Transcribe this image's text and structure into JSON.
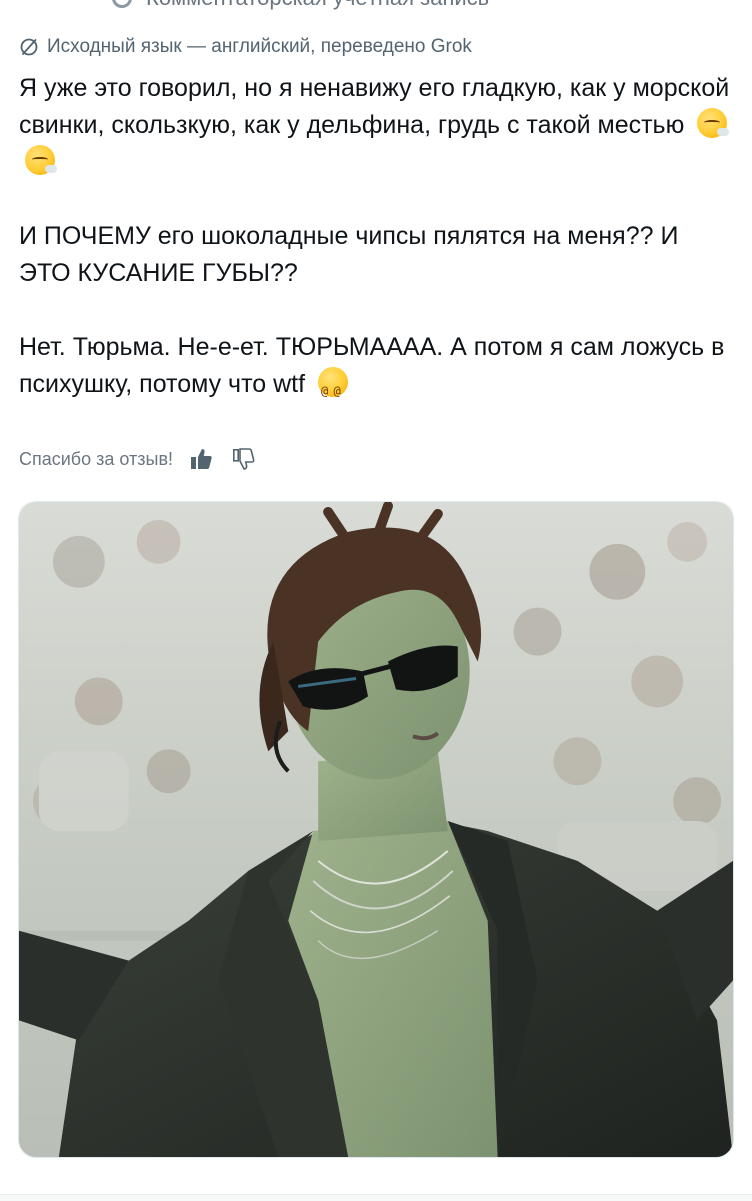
{
  "header_cut": {
    "text": "Комментаторская учётная запись"
  },
  "translation": {
    "icon": "translate-slash-icon",
    "text": "Исходный язык — английский, переведено Grok"
  },
  "tweet": {
    "paragraph1": "Я уже это говорил, но я ненавижу его гладкую, как у морской свинки, скользкую, как у дельфина, грудь с такой местью",
    "paragraph2": "И ПОЧЕМУ его шоколадные чипсы пялятся на меня?? И ЭТО КУСАНИЕ ГУБЫ??",
    "paragraph3": "Нет. Тюрьма. Не-е-ет. ТЮРЬМАААА. А потом я сам ложусь в психушку, потому что wtf",
    "emojis_p1": [
      "face-exhaling-emoji",
      "face-exhaling-emoji"
    ],
    "emoji_p3": "dizzy-face-emoji"
  },
  "feedback": {
    "label": "Спасибо за отзыв!",
    "thumbs_up_icon": "thumbs-up-icon",
    "thumbs_down_icon": "thumbs-down-icon"
  },
  "media": {
    "description_icon": "photo",
    "accent_colors": {
      "skin": "#8fa37e",
      "jacket": "#2b2f2b",
      "crowd": "#c7cac4",
      "hair": "#4a3324"
    }
  }
}
